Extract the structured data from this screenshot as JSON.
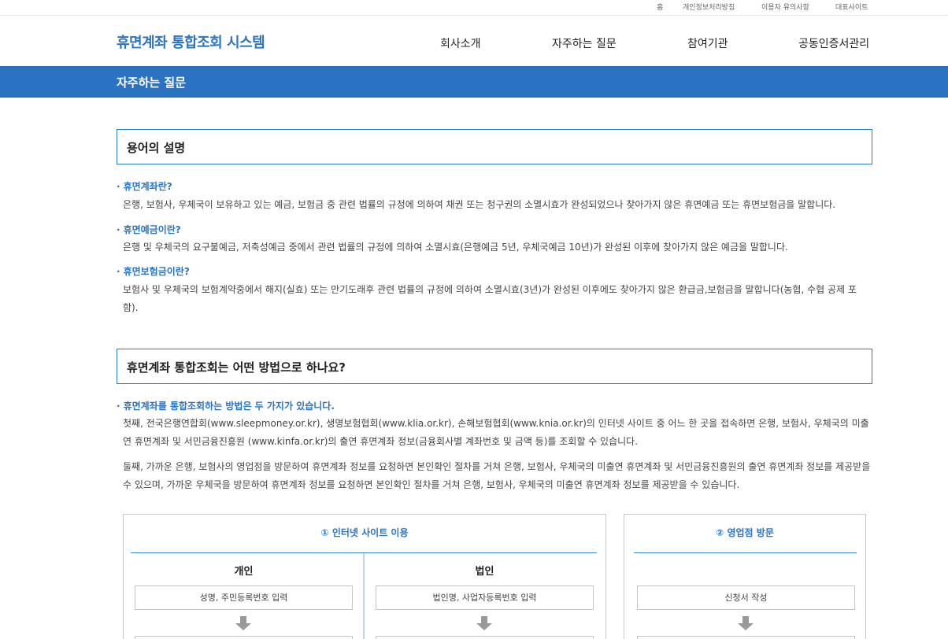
{
  "util_links": [
    "홈",
    "개인정보처리방침",
    "이용자 유의사항",
    "대표사이트"
  ],
  "logo": "휴면계좌 통합조회 시스템",
  "nav": [
    "회사소개",
    "자주하는 질문",
    "참여기관",
    "공동인증서관리"
  ],
  "page_title": "자주하는 질문",
  "terms_section": {
    "title": "용어의 설명",
    "items": [
      {
        "q": "휴면계좌란?",
        "a": "은행, 보험사, 우체국이 보유하고 있는 예금, 보험금 중 관련 법률의 규정에 의하여 채권 또는 청구권의 소멸시효가 완성되었으나 찾아가지 않은 휴면예금 또는 휴면보험금을 말합니다."
      },
      {
        "q": "휴면예금이란?",
        "a": "은행 및 우체국의 요구불예금, 저축성예금 중에서 관련 법률의 규정에 의하여 소멸시효(은행예금 5년, 우체국예금 10년)가 완성된 이후에 찾아가지 않은 예금을 말합니다."
      },
      {
        "q": "휴면보험금이란?",
        "a": "보험사 및 우체국의 보험계약중에서 해지(실효) 또는 만기도래후 관련 법률의 규정에 의하여 소멸시효(3년)가 완성된 이후에도 찾아가지 않은 환급금,보험금을 말합니다(농협, 수협 공제 포함)."
      }
    ]
  },
  "method_section": {
    "title": "휴면계좌 통합조회는 어떤 방법으로 하나요?",
    "q": "휴면계좌를 통합조회하는 방법은 두 가지가 있습니다.",
    "p1": "첫째, 전국은행연합회(www.sleepmoney.or.kr), 생명보험협회(www.klia.or.kr), 손해보험협회(www.knia.or.kr)의 인터넷 사이트 중 어느 한 곳을 접속하면 은행, 보험사, 우체국의 미출연 휴면계좌 및 서민금융진흥원 (www.kinfa.or.kr)의 출연 휴면계좌 정보(금융회사별 계좌번호 및 금액 등)를 조회할 수 있습니다.",
    "p2": "둘째, 가까운 은행, 보험사의 영업점을 방문하여 휴면계좌 정보를 요청하면 본인확인 절차를 거쳐 은행, 보험사, 우체국의 미출연 휴면계좌 및 서민금융진흥원의 출연 휴면계좌 정보를 제공받을 수 있으며, 가까운 우체국을 방문하여 휴면계좌 정보를 요청하면 본인확인 절차를 거쳐 은행, 보험사, 우체국의 미출연 휴면계좌 정보를 제공받을 수 있습니다."
  },
  "procedures": {
    "internet": {
      "title": "① 인터넷 사이트 이용",
      "personal": {
        "label": "개인",
        "step1": "성명, 주민등록번호 입력"
      },
      "corporate": {
        "label": "법인",
        "step1": "법인명, 사업자등록번호 입력"
      }
    },
    "branch": {
      "title": "② 영업점 방문",
      "step1": "신청서 작성"
    }
  }
}
